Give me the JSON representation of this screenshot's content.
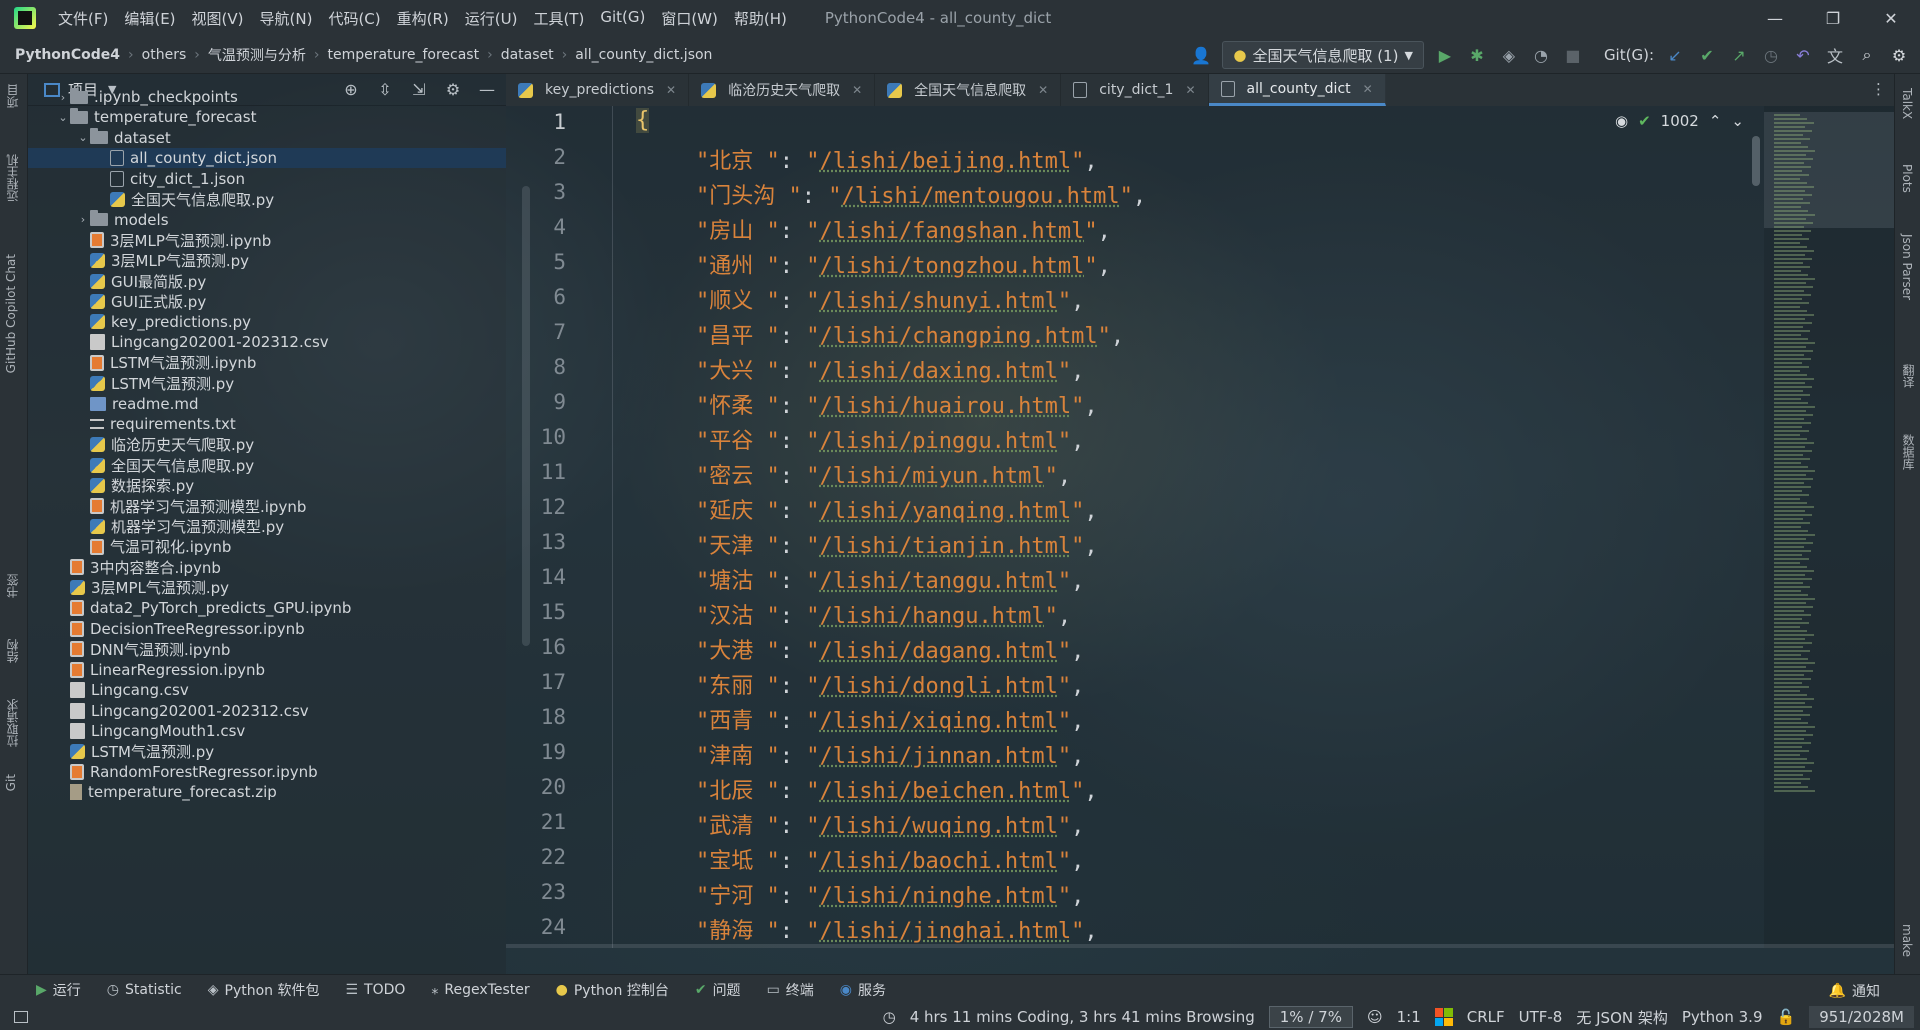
{
  "titlebar": {
    "menus": [
      "文件(F)",
      "编辑(E)",
      "视图(V)",
      "导航(N)",
      "代码(C)",
      "重构(R)",
      "运行(U)",
      "工具(T)",
      "Git(G)",
      "窗口(W)",
      "帮助(H)"
    ],
    "window_title": "PythonCode4 - all_county_dict"
  },
  "navbar": {
    "breadcrumbs": [
      "PythonCode4",
      "others",
      "气温预测与分析",
      "temperature_forecast",
      "dataset",
      "all_county_dict.json"
    ],
    "run_config": "全国天气信息爬取 (1)",
    "git_label": "Git(G):"
  },
  "left_strip": [
    "项目",
    "远程主机",
    "GitHub Copilot Chat",
    "书签",
    "结构",
    "拉取请求",
    "Git"
  ],
  "right_strip": [
    "TalkX",
    "Plots",
    "Json Parser",
    "翻译",
    "数据库",
    "make"
  ],
  "project_panel": {
    "title": "项目",
    "tree": [
      {
        "label": ".ipynb_checkpoints",
        "type": "folder",
        "indent": 1,
        "expand": "collapsed"
      },
      {
        "label": "temperature_forecast",
        "type": "folder",
        "indent": 1,
        "expand": "expanded"
      },
      {
        "label": "dataset",
        "type": "folder",
        "indent": 2,
        "expand": "expanded"
      },
      {
        "label": "all_county_dict.json",
        "type": "json",
        "indent": 3,
        "expand": "",
        "selected": true
      },
      {
        "label": "city_dict_1.json",
        "type": "json",
        "indent": 3,
        "expand": ""
      },
      {
        "label": "全国天气信息爬取.py",
        "type": "py",
        "indent": 3,
        "expand": ""
      },
      {
        "label": "models",
        "type": "folder",
        "indent": 2,
        "expand": "collapsed"
      },
      {
        "label": "3层MLP气温预测.ipynb",
        "type": "nb",
        "indent": 2,
        "expand": ""
      },
      {
        "label": "3层MLP气温预测.py",
        "type": "py",
        "indent": 2,
        "expand": ""
      },
      {
        "label": "GUI最简版.py",
        "type": "py",
        "indent": 2,
        "expand": ""
      },
      {
        "label": "GUI正式版.py",
        "type": "py",
        "indent": 2,
        "expand": ""
      },
      {
        "label": "key_predictions.py",
        "type": "py",
        "indent": 2,
        "expand": ""
      },
      {
        "label": "Lingcang202001-202312.csv",
        "type": "csv",
        "indent": 2,
        "expand": ""
      },
      {
        "label": "LSTM气温预测.ipynb",
        "type": "nb",
        "indent": 2,
        "expand": ""
      },
      {
        "label": "LSTM气温预测.py",
        "type": "py",
        "indent": 2,
        "expand": ""
      },
      {
        "label": "readme.md",
        "type": "md",
        "indent": 2,
        "expand": ""
      },
      {
        "label": "requirements.txt",
        "type": "txt",
        "indent": 2,
        "expand": ""
      },
      {
        "label": "临沧历史天气爬取.py",
        "type": "py",
        "indent": 2,
        "expand": ""
      },
      {
        "label": "全国天气信息爬取.py",
        "type": "py",
        "indent": 2,
        "expand": ""
      },
      {
        "label": "数据探索.py",
        "type": "py",
        "indent": 2,
        "expand": ""
      },
      {
        "label": "机器学习气温预测模型.ipynb",
        "type": "nb",
        "indent": 2,
        "expand": ""
      },
      {
        "label": "机器学习气温预测模型.py",
        "type": "py",
        "indent": 2,
        "expand": ""
      },
      {
        "label": "气温可视化.ipynb",
        "type": "nb",
        "indent": 2,
        "expand": ""
      },
      {
        "label": "3中内容整合.ipynb",
        "type": "nb",
        "indent": 1,
        "expand": ""
      },
      {
        "label": "3层MPL气温预测.py",
        "type": "py",
        "indent": 1,
        "expand": ""
      },
      {
        "label": "data2_PyTorch_predicts_GPU.ipynb",
        "type": "nb",
        "indent": 1,
        "expand": ""
      },
      {
        "label": "DecisionTreeRegressor.ipynb",
        "type": "nb",
        "indent": 1,
        "expand": ""
      },
      {
        "label": "DNN气温预测.ipynb",
        "type": "nb",
        "indent": 1,
        "expand": ""
      },
      {
        "label": "LinearRegression.ipynb",
        "type": "nb",
        "indent": 1,
        "expand": ""
      },
      {
        "label": "Lingcang.csv",
        "type": "csv",
        "indent": 1,
        "expand": ""
      },
      {
        "label": "Lingcang202001-202312.csv",
        "type": "csv",
        "indent": 1,
        "expand": ""
      },
      {
        "label": "LingcangMouth1.csv",
        "type": "csv",
        "indent": 1,
        "expand": ""
      },
      {
        "label": "LSTM气温预测.py",
        "type": "py",
        "indent": 1,
        "expand": ""
      },
      {
        "label": "RandomForestRegressor.ipynb",
        "type": "nb",
        "indent": 1,
        "expand": ""
      },
      {
        "label": "temperature_forecast.zip",
        "type": "zip",
        "indent": 1,
        "expand": ""
      }
    ]
  },
  "tabs": [
    {
      "label": "key_predictions",
      "active": false
    },
    {
      "label": "临沧历史天气爬取",
      "active": false
    },
    {
      "label": "全国天气信息爬取",
      "active": false
    },
    {
      "label": "city_dict_1",
      "active": false
    },
    {
      "label": "all_county_dict",
      "active": true
    }
  ],
  "editor": {
    "inspection_count": "1002",
    "open_brace": "{",
    "entries": [
      {
        "key": "北京 ",
        "value": "/lishi/beijing.html"
      },
      {
        "key": "门头沟 ",
        "value": "/lishi/mentougou.html"
      },
      {
        "key": "房山 ",
        "value": "/lishi/fangshan.html"
      },
      {
        "key": "通州 ",
        "value": "/lishi/tongzhou.html"
      },
      {
        "key": "顺义 ",
        "value": "/lishi/shunyi.html"
      },
      {
        "key": "昌平 ",
        "value": "/lishi/changping.html"
      },
      {
        "key": "大兴 ",
        "value": "/lishi/daxing.html"
      },
      {
        "key": "怀柔 ",
        "value": "/lishi/huairou.html"
      },
      {
        "key": "平谷 ",
        "value": "/lishi/pinggu.html"
      },
      {
        "key": "密云 ",
        "value": "/lishi/miyun.html"
      },
      {
        "key": "延庆 ",
        "value": "/lishi/yanqing.html"
      },
      {
        "key": "天津 ",
        "value": "/lishi/tianjin.html"
      },
      {
        "key": "塘沽 ",
        "value": "/lishi/tanggu.html"
      },
      {
        "key": "汉沽 ",
        "value": "/lishi/hangu.html"
      },
      {
        "key": "大港 ",
        "value": "/lishi/dagang.html"
      },
      {
        "key": "东丽 ",
        "value": "/lishi/dongli.html"
      },
      {
        "key": "西青 ",
        "value": "/lishi/xiqing.html"
      },
      {
        "key": "津南 ",
        "value": "/lishi/jinnan.html"
      },
      {
        "key": "北辰 ",
        "value": "/lishi/beichen.html"
      },
      {
        "key": "武清 ",
        "value": "/lishi/wuqing.html"
      },
      {
        "key": "宝坻 ",
        "value": "/lishi/baochi.html"
      },
      {
        "key": "宁河 ",
        "value": "/lishi/ninghe.html"
      },
      {
        "key": "静海 ",
        "value": "/lishi/jinghai.html"
      }
    ]
  },
  "bottom_tools": [
    {
      "label": "运行",
      "icon": "play-icon"
    },
    {
      "label": "Statistic",
      "icon": "clock-icon"
    },
    {
      "label": "Python 软件包",
      "icon": "layers-icon"
    },
    {
      "label": "TODO",
      "icon": "list-icon"
    },
    {
      "label": "RegexTester",
      "icon": "regex-icon"
    },
    {
      "label": "Python 控制台",
      "icon": "python-icon"
    },
    {
      "label": "问题",
      "icon": "check-icon"
    },
    {
      "label": "终端",
      "icon": "terminal-icon"
    },
    {
      "label": "服务",
      "icon": "services-icon"
    }
  ],
  "notifications_label": "通知",
  "statusbar": {
    "coding_time": "4 hrs 11 mins Coding, 3 hrs 41 mins Browsing",
    "progress": "1% /  7%",
    "position": "1:1",
    "line_ending": "CRLF",
    "encoding": "UTF-8",
    "schema": "无 JSON 架构",
    "interpreter": "Python 3.9",
    "memory": "951/2028M"
  },
  "colors": {
    "selection": "#1f3a56",
    "string": "#d9833b",
    "accent": "#4a88c7"
  }
}
